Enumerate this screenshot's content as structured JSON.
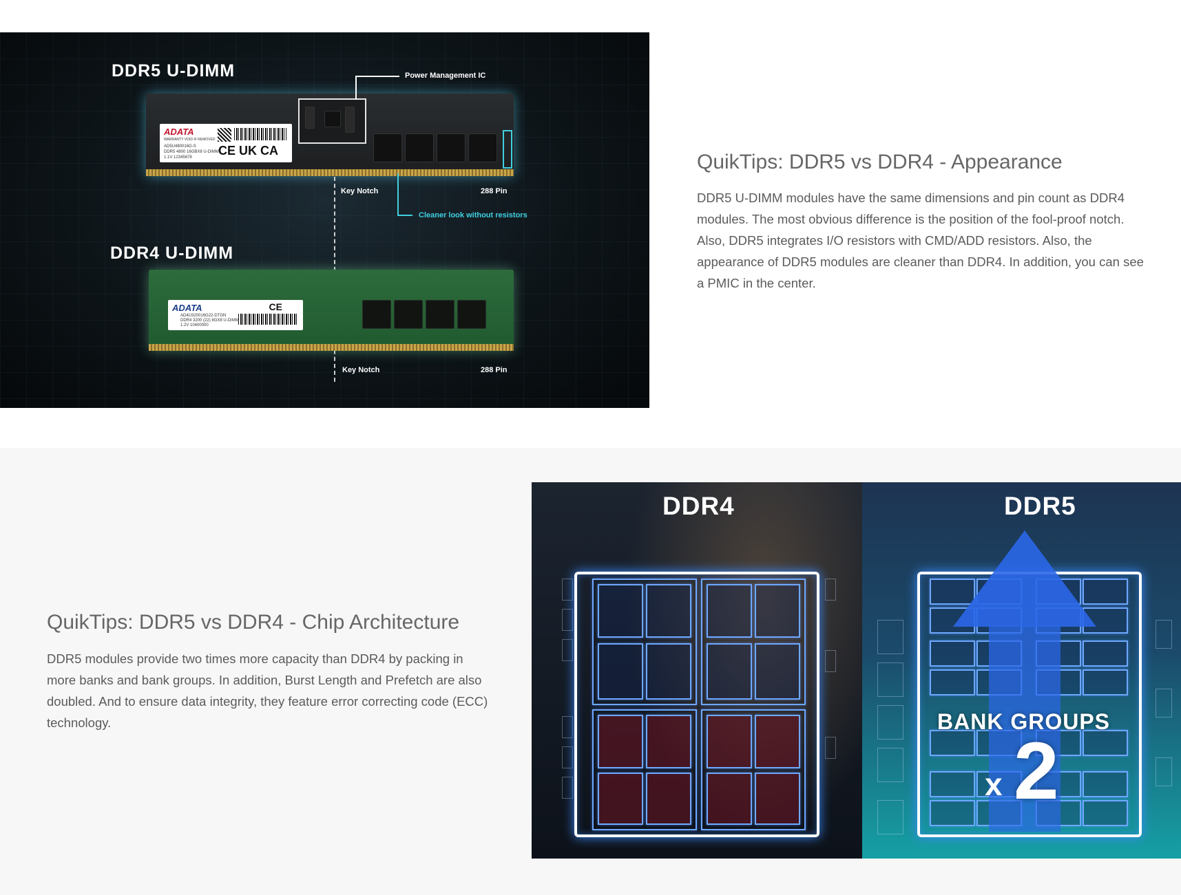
{
  "section1": {
    "image": {
      "ddr5_title": "DDR5 U-DIMM",
      "ddr4_title": "DDR4 U-DIMM",
      "callouts": {
        "pmic": "Power Management IC",
        "ddr5_key_notch": "Key Notch",
        "ddr5_pins": "288 Pin",
        "resistors": "Cleaner look without resistors",
        "ddr4_key_notch": "Key Notch",
        "ddr4_pins": "288 Pin"
      },
      "ddr5_label": {
        "brand": "ADATA",
        "line1": "WARRANTY VOID IF REMOVED",
        "line2": "AD5U480016G-S",
        "line3": "DDR5 4800 16GBX8 U-DIMM",
        "line4": "1.1V 12345678",
        "cert": "CE UK CA"
      },
      "ddr4_label": {
        "brand": "ADATA",
        "line1": "AD4U320016G22-DTGN",
        "line2": "DDR4 3200 (22) 8GX8 U-DIMM",
        "line3": "1.2V 10400000",
        "cert": "CE"
      }
    },
    "title": "QuikTips: DDR5 vs DDR4 - Appearance",
    "body": "DDR5 U-DIMM modules have the same dimensions and pin count as DDR4 modules. The most obvious difference is the position of the fool-proof notch. Also, DDR5 integrates I/O resistors with CMD/ADD resistors. Also, the appearance of DDR5 modules are cleaner than DDR4. In addition, you can see a PMIC in the center."
  },
  "section2": {
    "title": "QuikTips: DDR5 vs DDR4 - Chip Architecture",
    "body": "DDR5 modules provide two times more capacity than DDR4 by packing in more banks and bank groups. In addition, Burst Length and Prefetch are also doubled. And to ensure data integrity, they feature error correcting code (ECC) technology.",
    "image": {
      "left_title": "DDR4",
      "right_title": "DDR5",
      "bank_label": "BANK GROUPS",
      "multiplier_x": "x",
      "multiplier_value": "2"
    }
  },
  "colors": {
    "title": "#666666",
    "body": "#5b5b5b",
    "accent_cyan": "#3fd0e0",
    "accent_blue": "#2b67e8"
  }
}
